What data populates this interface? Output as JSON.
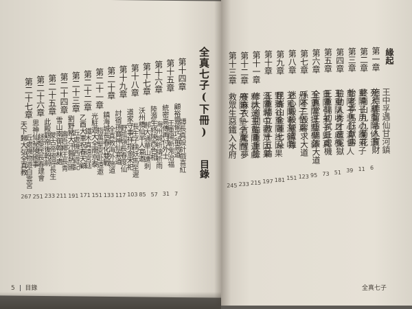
{
  "book": {
    "title": "全真七子",
    "volume": "(下冊)",
    "toc_label": "目錄",
    "foot_left_num": "5",
    "foot_left_label": "目錄",
    "foot_right_label": "全真七子"
  },
  "right_page": {
    "header": "緣起",
    "entries": [
      {
        "chapter": "第一章",
        "title": "施德德留活人寶財",
        "page": "6"
      },
      {
        "chapter": "第二章",
        "title": "終南山九九菊花",
        "page": "11"
      },
      {
        "chapter": "第三章",
        "title": "怡老亭馬鈺獻壽",
        "page": "39"
      },
      {
        "chapter": "第四章",
        "title": "驗動人秀才遭冤獄",
        "page": "51"
      },
      {
        "chapter": "第五章",
        "title": "王重陽初試丘處機",
        "page": "73"
      },
      {
        "chapter": "第六章",
        "title": "全真堂王重陽演大道",
        "page": "95"
      },
      {
        "chapter": "第七章",
        "title": "孫不二毀容求大道",
        "page": "123"
      },
      {
        "chapter": "第八章",
        "title": "迷心殿殺鹽遭難",
        "page": "151"
      },
      {
        "chapter": "第九章",
        "title": "昆崙山金蓮七朵",
        "page": "181"
      },
      {
        "chapter": "第十章",
        "title": "王重陽立教十五論",
        "page": "197"
      },
      {
        "chapter": "第十一章",
        "title": "修大道關隘重重險",
        "page": "215"
      },
      {
        "chapter": "第十二章",
        "title": "賽麻衣一言驚醒夢",
        "page": "233"
      },
      {
        "chapter": "第十三章",
        "title": "救眾生惡鐵入水府",
        "page": "245"
      }
    ],
    "secondary": [
      "王中孚遇仙甘河鎮",
      "死人墓重陽修道",
      "重陽子用心護弟子",
      "重陽子悲心濟世人",
      "王重陽收丘處機",
      "重陽引弟子歸真",
      "王重陽提點學藝",
      "丹陽子悟真",
      "王重陽寧海鶴鳴",
      "野鵝谷重陽說因果",
      "洛陽城中觀眾因果",
      "釋群迷王重陽遊戲",
      "丹陽子墊全真門",
      "馬真人妙解通關",
      "丘處機磻溪積功德",
      "長春子龍門大丹成"
    ]
  },
  "left_page": {
    "entries": [
      {
        "chapter": "第十四章",
        "title": "顧裕豐偷巧留高道",
        "page": "7"
      },
      {
        "chapter": "第十五章",
        "title": "統密高傳再付外士",
        "page": "31"
      },
      {
        "chapter": "第十六章",
        "title": "陸游生終陝西色相",
        "page": "57"
      },
      {
        "chapter": "第十七章",
        "title": "沃州橋仙半人宴邀",
        "page": "85"
      },
      {
        "chapter": "第十八章",
        "title": "道家守事祥指金宋祀",
        "page": "103"
      },
      {
        "chapter": "第十九章",
        "title": "討宿孫寶神仙宴道",
        "page": "117"
      },
      {
        "chapter": "第二十章",
        "title": "鎮海城長春化雙戰",
        "page": "133"
      },
      {
        "chapter": "第二十一章",
        "title": "光駐遊大全南京泰",
        "page": "151"
      },
      {
        "chapter": "第二十二章",
        "title": "乙酉大軍祝春天顧",
        "page": "171"
      },
      {
        "chapter": "第二十三章",
        "title": "劉野豬大汗醫熱國",
        "page": "191"
      },
      {
        "chapter": "第二十四章",
        "title": "雪山南御翰林處",
        "page": "211"
      },
      {
        "chapter": "第二十五章",
        "title": "此殿觀帝後乾前",
        "page": "233"
      },
      {
        "chapter": "第二十六章",
        "title": "思神仙祕陵國事",
        "page": "251"
      },
      {
        "chapter": "第二十七章",
        "title": "天下歸大弘全真教",
        "page": "267"
      }
    ],
    "secondary": [
      "譚長真設計戲喜紅",
      "王重陽斬鬼治福",
      "海州城祈禱祈雨",
      "郝大通華山遭刺",
      "長生子擒妖馬至遲",
      "野孤嶺長春度仙",
      "全真教海外施道",
      "指萬聖宮赴遠邀",
      "鐵木真遠宮廷",
      "丘處機西遊記",
      "壽吾鄉王長青",
      "蒙古帝國得長生",
      "拯黎民長春建會",
      "丘處機物遊白雲宮"
    ]
  }
}
